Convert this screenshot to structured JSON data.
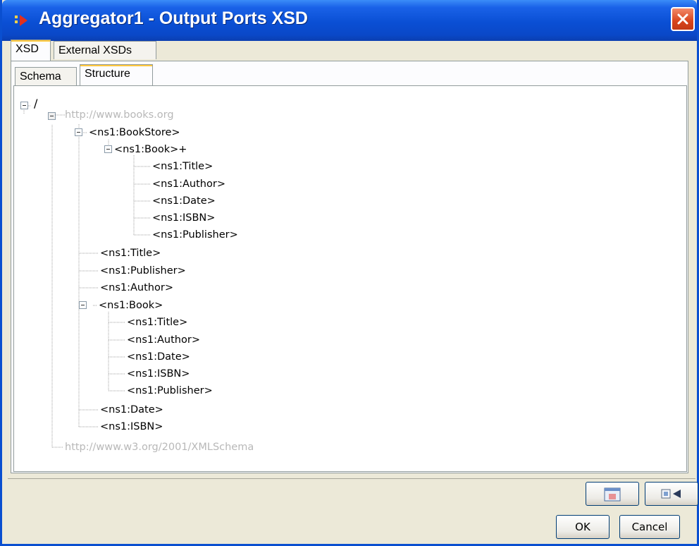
{
  "window": {
    "title": "Aggregator1 - Output Ports XSD",
    "colors": {
      "titlebar": "#0a4fd4",
      "close": "#d9441c",
      "active_tab_accent": "#ffc83c",
      "border": "#0a4fd0"
    }
  },
  "outer_tabs": [
    {
      "label": "XSD",
      "active": true
    },
    {
      "label": "External XSDs",
      "active": false
    }
  ],
  "inner_tabs": [
    {
      "label": "Schema",
      "active": false
    },
    {
      "label": "Structure",
      "active": true
    }
  ],
  "tree": {
    "root": "/",
    "namespace_1": "http://www.books.org",
    "bookstore": "<ns1:BookStore>",
    "book_multi": "<ns1:Book>+",
    "book_multi_children": [
      "<ns1:Title>",
      "<ns1:Author>",
      "<ns1:Date>",
      "<ns1:ISBN>",
      "<ns1:Publisher>"
    ],
    "top_level_elements": [
      "<ns1:Title>",
      "<ns1:Publisher>",
      "<ns1:Author>"
    ],
    "book": "<ns1:Book>",
    "book_children": [
      "<ns1:Title>",
      "<ns1:Author>",
      "<ns1:Date>",
      "<ns1:ISBN>",
      "<ns1:Publisher>"
    ],
    "trailing_elements": [
      "<ns1:Date>",
      "<ns1:ISBN>"
    ],
    "namespace_2": "http://www.w3.org/2001/XMLSchema"
  },
  "buttons": {
    "ok": "OK",
    "cancel": "Cancel",
    "icon_button_1": "image-icon",
    "icon_button_2": "export-arrow-icon"
  }
}
